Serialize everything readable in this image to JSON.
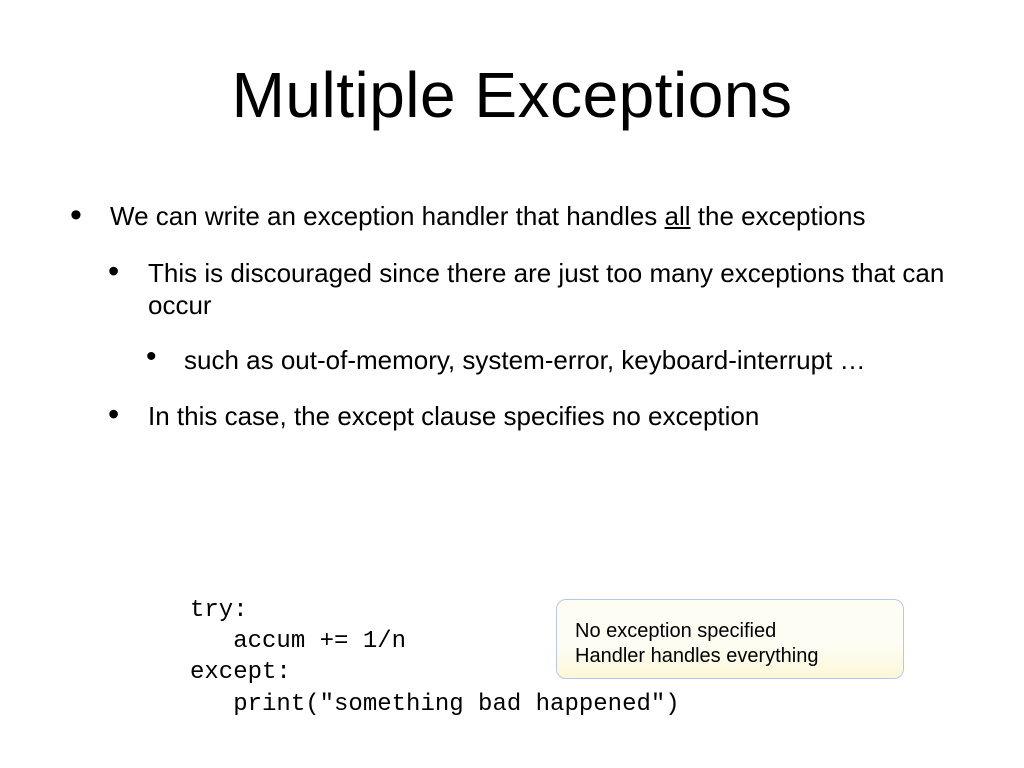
{
  "title": "Multiple Exceptions",
  "bullets": {
    "l1_pre": "We can write an exception handler that handles ",
    "l1_all": "all",
    "l1_post": " the exceptions",
    "l2a": "This is discouraged since there are just too many exceptions that can occur",
    "l3a": "such as out-of-memory, system-error, keyboard-interrupt …",
    "l2b": "In this case, the except clause specifies no exception"
  },
  "code": "try:\n   accum += 1/n\nexcept:\n   print(\"something bad happened\")",
  "callout": {
    "line1": "No exception specified",
    "line2": "Handler handles everything"
  }
}
